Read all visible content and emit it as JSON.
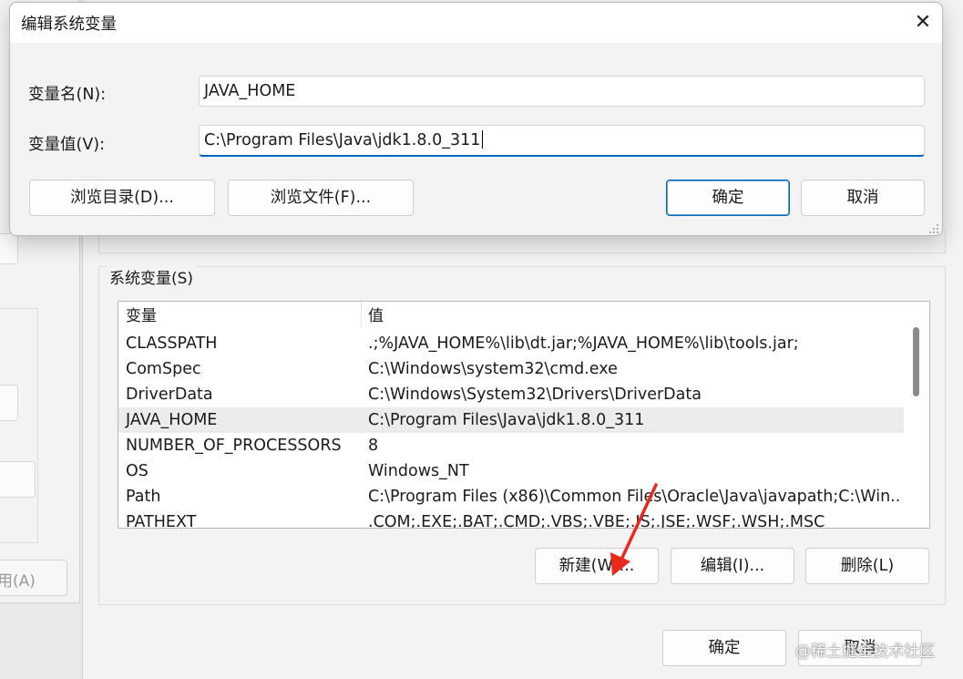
{
  "edit_dialog": {
    "title": "编辑系统变量",
    "name_label": "变量名(N):",
    "name_value": "JAVA_HOME",
    "value_label": "变量值(V):",
    "value_value": "C:\\Program Files\\Java\\jdk1.8.0_311",
    "browse_dir_label": "浏览目录(D)...",
    "browse_file_label": "浏览文件(F)...",
    "ok_label": "确定",
    "cancel_label": "取消",
    "close_icon": "close-icon"
  },
  "env_window": {
    "system_vars_label": "系统变量(S)",
    "columns": [
      "变量",
      "值"
    ],
    "rows": [
      {
        "name": "CLASSPATH",
        "value": ".;%JAVA_HOME%\\lib\\dt.jar;%JAVA_HOME%\\lib\\tools.jar;"
      },
      {
        "name": "ComSpec",
        "value": "C:\\Windows\\system32\\cmd.exe"
      },
      {
        "name": "DriverData",
        "value": "C:\\Windows\\System32\\Drivers\\DriverData"
      },
      {
        "name": "JAVA_HOME",
        "value": "C:\\Program Files\\Java\\jdk1.8.0_311"
      },
      {
        "name": "NUMBER_OF_PROCESSORS",
        "value": "8"
      },
      {
        "name": "OS",
        "value": "Windows_NT"
      },
      {
        "name": "Path",
        "value": "C:\\Program Files (x86)\\Common Files\\Oracle\\Java\\javapath;C:\\Win..."
      },
      {
        "name": "PATHEXT",
        "value": ".COM;.EXE;.BAT;.CMD;.VBS;.VBE;.JS;.JSE;.WSF;.WSH;.MSC"
      }
    ],
    "selected_row": "JAVA_HOME",
    "new_label": "新建(W)...",
    "edit_label": "编辑(I)...",
    "delete_label": "删除(L)",
    "ok_label": "确定",
    "cancel_label": "取消"
  },
  "left_window": {
    "apply_label": "用(A)"
  },
  "watermark": "@稀土掘金技术社区",
  "colors": {
    "accent": "#0067c0",
    "arrow": "#e8291c",
    "selected_row": "#ececec"
  }
}
